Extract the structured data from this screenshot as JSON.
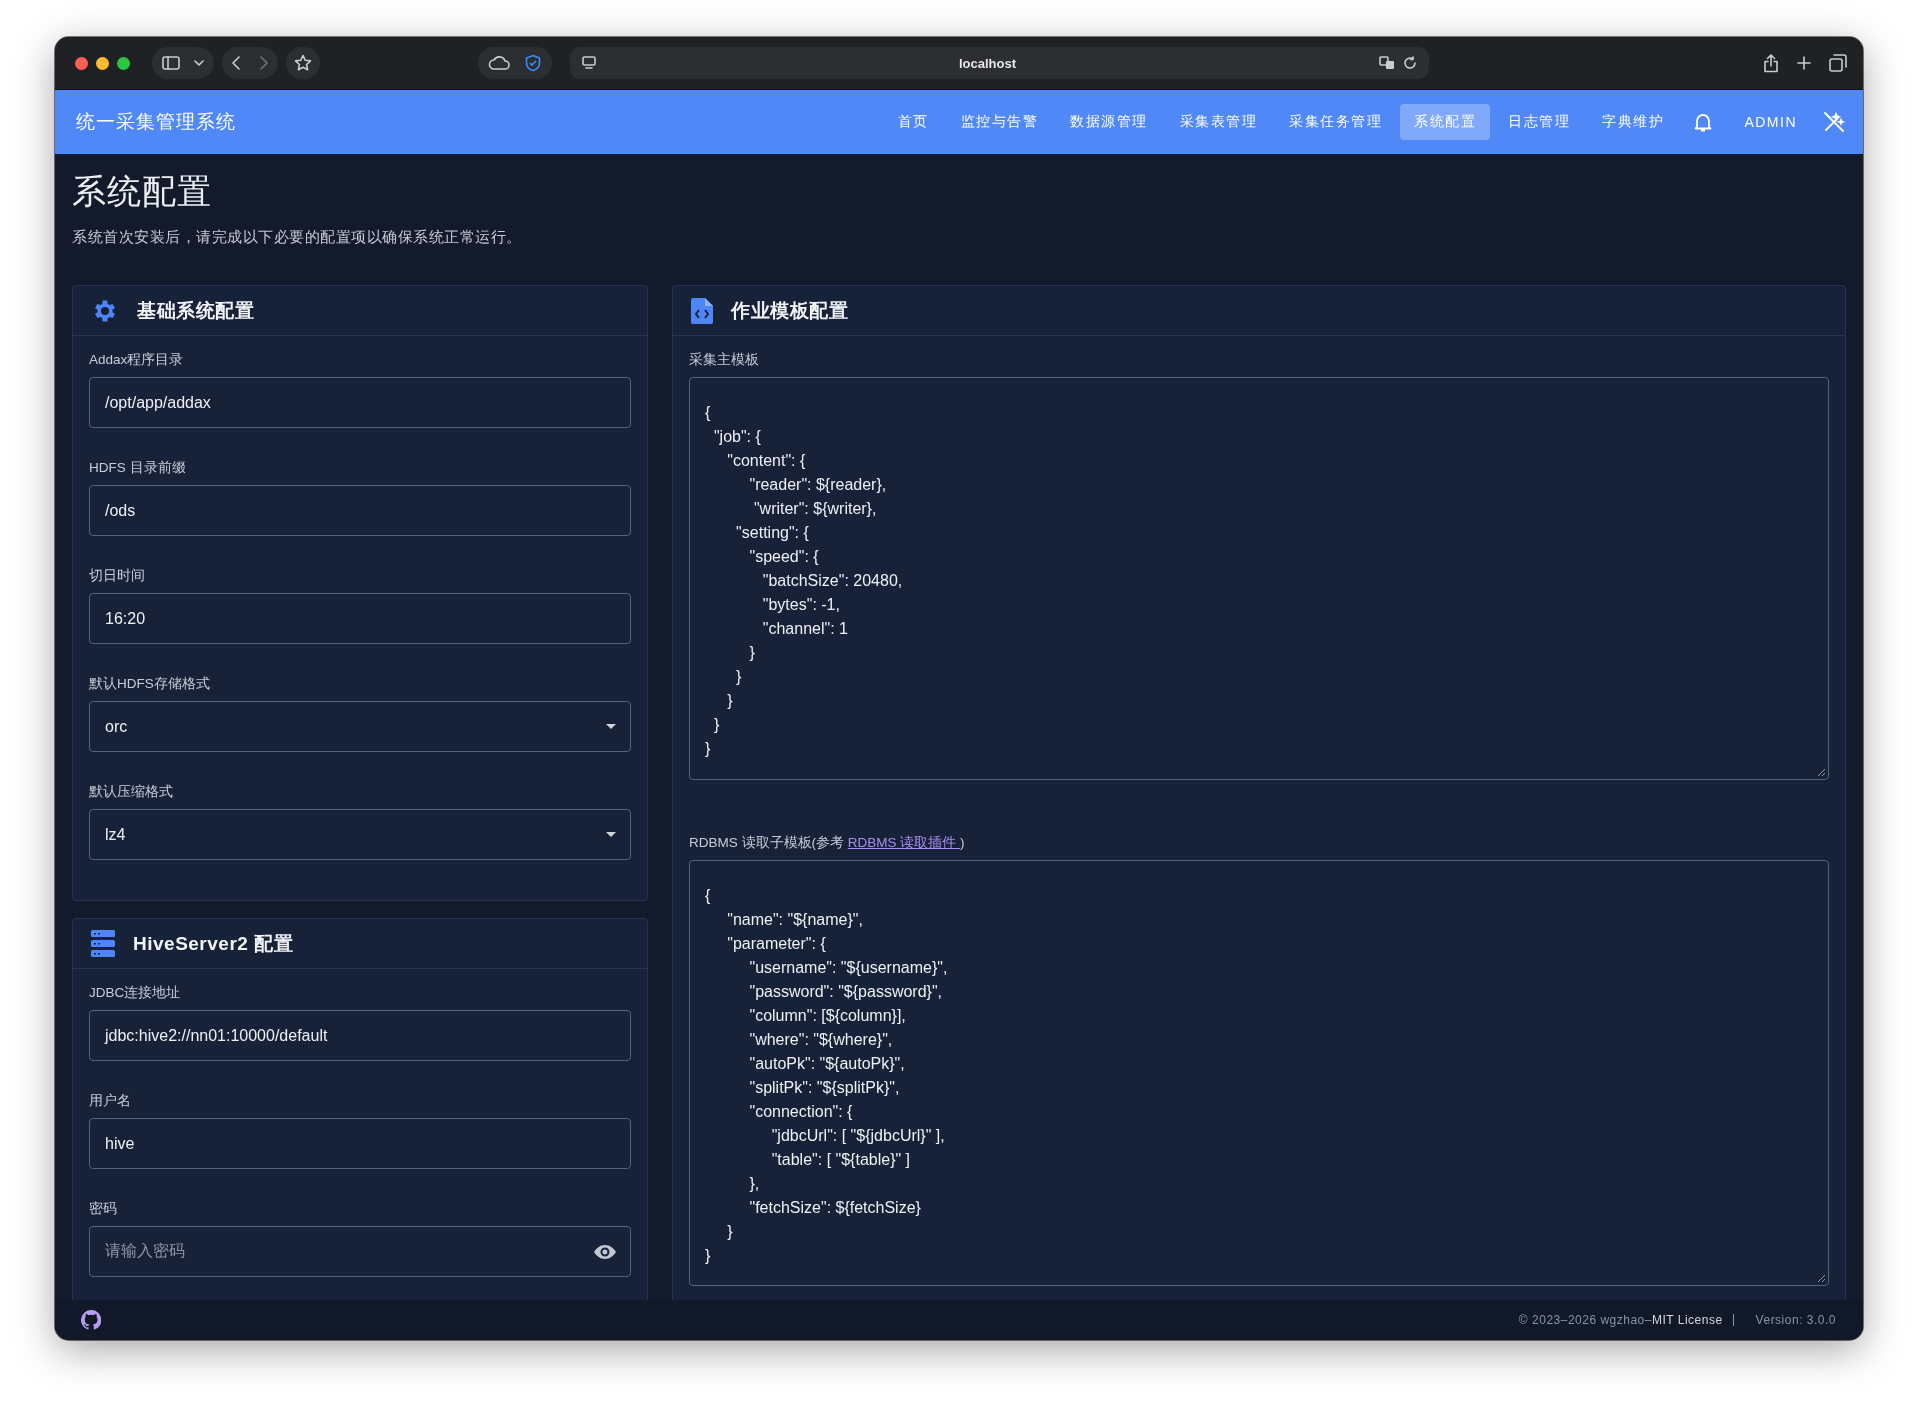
{
  "browser": {
    "url": "localhost"
  },
  "app": {
    "title": "统一采集管理系统",
    "nav": [
      {
        "label": "首页",
        "selected": false
      },
      {
        "label": "监控与告警",
        "selected": false
      },
      {
        "label": "数据源管理",
        "selected": false
      },
      {
        "label": "采集表管理",
        "selected": false
      },
      {
        "label": "采集任务管理",
        "selected": false
      },
      {
        "label": "系统配置",
        "selected": true
      },
      {
        "label": "日志管理",
        "selected": false
      },
      {
        "label": "字典维护",
        "selected": false
      }
    ],
    "user": "ADMIN"
  },
  "page": {
    "title": "系统配置",
    "subtitle": "系统首次安装后，请完成以下必要的配置项以确保系统正常运行。"
  },
  "left_cards": [
    {
      "kind": "gear",
      "title": "基础系统配置",
      "fields": [
        {
          "kind": "text",
          "label": "Addax程序目录",
          "value": "/opt/app/addax"
        },
        {
          "kind": "text",
          "label": "HDFS 目录前缀",
          "value": "/ods"
        },
        {
          "kind": "text",
          "label": "切日时间",
          "value": "16:20"
        },
        {
          "kind": "select",
          "label": "默认HDFS存储格式",
          "value": "orc"
        },
        {
          "kind": "select",
          "label": "默认压缩格式",
          "value": "lz4"
        }
      ]
    },
    {
      "kind": "server",
      "title": "HiveServer2 配置",
      "fields": [
        {
          "kind": "text",
          "label": "JDBC连接地址",
          "value": "jdbc:hive2://nn01:10000/default"
        },
        {
          "kind": "text",
          "label": "用户名",
          "value": "hive"
        },
        {
          "kind": "password",
          "label": "密码",
          "placeholder": "请输入密码"
        }
      ]
    }
  ],
  "right_card": {
    "kind": "file-code",
    "title": "作业模板配置",
    "templates": [
      {
        "label": "采集主模板",
        "code": "{\n  \"job\": {\n     \"content\": {\n          \"reader\": ${reader},\n           \"writer\": ${writer},\n       \"setting\": {\n          \"speed\": {\n             \"batchSize\": 20480,\n             \"bytes\": -1,\n             \"channel\": 1\n          }\n       }\n     }\n  }\n}"
      },
      {
        "label": "RDBMS 读取子模板(参考 ",
        "link": "RDBMS 读取插件 ",
        "label_after": ")",
        "code": "{\n     \"name\": \"${name}\",\n     \"parameter\": {\n          \"username\": \"${username}\",\n          \"password\": \"${password}\",\n          \"column\": [${column}],\n          \"where\": \"${where}\",\n          \"autoPk\": \"${autoPk}\",\n          \"splitPk\": \"${splitPk}\",\n          \"connection\": {\n               \"jdbcUrl\": [ \"${jdbcUrl}\" ],\n               \"table\": [ \"${table}\" ]\n          },\n          \"fetchSize\": ${fetchSize}\n     }\n}"
      }
    ]
  },
  "footer": {
    "copyright": "© 2023–2026 wgzhao–",
    "license": "MIT License",
    "version": "Version: 3.0.0"
  }
}
